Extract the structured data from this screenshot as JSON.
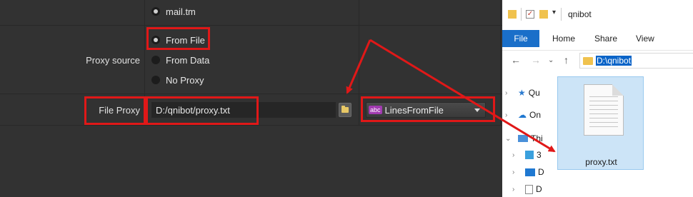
{
  "settings": {
    "row1": {
      "option": "mail.tm"
    },
    "proxy_source": {
      "label": "Proxy source",
      "options": [
        "From File",
        "From Data",
        "No Proxy"
      ],
      "selected": "From File"
    },
    "file_proxy": {
      "label": "File Proxy",
      "value": "D:/qnibot/proxy.txt",
      "type_badge": "abc",
      "type_value": "LinesFromFile"
    }
  },
  "explorer": {
    "title": "qnibot",
    "ribbon_tabs": [
      "File",
      "Home",
      "Share",
      "View"
    ],
    "address": "D:\\qnibot",
    "tree": [
      "Qu",
      "On",
      "Thi",
      "3",
      "D",
      "D"
    ],
    "file": {
      "name": "proxy.txt"
    }
  },
  "colors": {
    "app_bg": "#323232",
    "highlight_red": "#e01818",
    "explorer_accent": "#1a6fc9",
    "selection": "#cce4f7"
  }
}
